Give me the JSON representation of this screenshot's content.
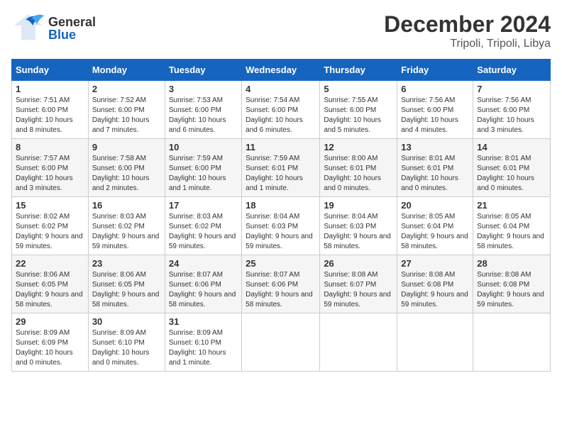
{
  "header": {
    "logo_general": "General",
    "logo_blue": "Blue",
    "title": "December 2024",
    "subtitle": "Tripoli, Tripoli, Libya"
  },
  "days_of_week": [
    "Sunday",
    "Monday",
    "Tuesday",
    "Wednesday",
    "Thursday",
    "Friday",
    "Saturday"
  ],
  "weeks": [
    [
      {
        "num": "1",
        "sunrise": "Sunrise: 7:51 AM",
        "sunset": "Sunset: 6:00 PM",
        "daylight": "Daylight: 10 hours and 8 minutes."
      },
      {
        "num": "2",
        "sunrise": "Sunrise: 7:52 AM",
        "sunset": "Sunset: 6:00 PM",
        "daylight": "Daylight: 10 hours and 7 minutes."
      },
      {
        "num": "3",
        "sunrise": "Sunrise: 7:53 AM",
        "sunset": "Sunset: 6:00 PM",
        "daylight": "Daylight: 10 hours and 6 minutes."
      },
      {
        "num": "4",
        "sunrise": "Sunrise: 7:54 AM",
        "sunset": "Sunset: 6:00 PM",
        "daylight": "Daylight: 10 hours and 6 minutes."
      },
      {
        "num": "5",
        "sunrise": "Sunrise: 7:55 AM",
        "sunset": "Sunset: 6:00 PM",
        "daylight": "Daylight: 10 hours and 5 minutes."
      },
      {
        "num": "6",
        "sunrise": "Sunrise: 7:56 AM",
        "sunset": "Sunset: 6:00 PM",
        "daylight": "Daylight: 10 hours and 4 minutes."
      },
      {
        "num": "7",
        "sunrise": "Sunrise: 7:56 AM",
        "sunset": "Sunset: 6:00 PM",
        "daylight": "Daylight: 10 hours and 3 minutes."
      }
    ],
    [
      {
        "num": "8",
        "sunrise": "Sunrise: 7:57 AM",
        "sunset": "Sunset: 6:00 PM",
        "daylight": "Daylight: 10 hours and 3 minutes."
      },
      {
        "num": "9",
        "sunrise": "Sunrise: 7:58 AM",
        "sunset": "Sunset: 6:00 PM",
        "daylight": "Daylight: 10 hours and 2 minutes."
      },
      {
        "num": "10",
        "sunrise": "Sunrise: 7:59 AM",
        "sunset": "Sunset: 6:00 PM",
        "daylight": "Daylight: 10 hours and 1 minute."
      },
      {
        "num": "11",
        "sunrise": "Sunrise: 7:59 AM",
        "sunset": "Sunset: 6:01 PM",
        "daylight": "Daylight: 10 hours and 1 minute."
      },
      {
        "num": "12",
        "sunrise": "Sunrise: 8:00 AM",
        "sunset": "Sunset: 6:01 PM",
        "daylight": "Daylight: 10 hours and 0 minutes."
      },
      {
        "num": "13",
        "sunrise": "Sunrise: 8:01 AM",
        "sunset": "Sunset: 6:01 PM",
        "daylight": "Daylight: 10 hours and 0 minutes."
      },
      {
        "num": "14",
        "sunrise": "Sunrise: 8:01 AM",
        "sunset": "Sunset: 6:01 PM",
        "daylight": "Daylight: 10 hours and 0 minutes."
      }
    ],
    [
      {
        "num": "15",
        "sunrise": "Sunrise: 8:02 AM",
        "sunset": "Sunset: 6:02 PM",
        "daylight": "Daylight: 9 hours and 59 minutes."
      },
      {
        "num": "16",
        "sunrise": "Sunrise: 8:03 AM",
        "sunset": "Sunset: 6:02 PM",
        "daylight": "Daylight: 9 hours and 59 minutes."
      },
      {
        "num": "17",
        "sunrise": "Sunrise: 8:03 AM",
        "sunset": "Sunset: 6:02 PM",
        "daylight": "Daylight: 9 hours and 59 minutes."
      },
      {
        "num": "18",
        "sunrise": "Sunrise: 8:04 AM",
        "sunset": "Sunset: 6:03 PM",
        "daylight": "Daylight: 9 hours and 59 minutes."
      },
      {
        "num": "19",
        "sunrise": "Sunrise: 8:04 AM",
        "sunset": "Sunset: 6:03 PM",
        "daylight": "Daylight: 9 hours and 58 minutes."
      },
      {
        "num": "20",
        "sunrise": "Sunrise: 8:05 AM",
        "sunset": "Sunset: 6:04 PM",
        "daylight": "Daylight: 9 hours and 58 minutes."
      },
      {
        "num": "21",
        "sunrise": "Sunrise: 8:05 AM",
        "sunset": "Sunset: 6:04 PM",
        "daylight": "Daylight: 9 hours and 58 minutes."
      }
    ],
    [
      {
        "num": "22",
        "sunrise": "Sunrise: 8:06 AM",
        "sunset": "Sunset: 6:05 PM",
        "daylight": "Daylight: 9 hours and 58 minutes."
      },
      {
        "num": "23",
        "sunrise": "Sunrise: 8:06 AM",
        "sunset": "Sunset: 6:05 PM",
        "daylight": "Daylight: 9 hours and 58 minutes."
      },
      {
        "num": "24",
        "sunrise": "Sunrise: 8:07 AM",
        "sunset": "Sunset: 6:06 PM",
        "daylight": "Daylight: 9 hours and 58 minutes."
      },
      {
        "num": "25",
        "sunrise": "Sunrise: 8:07 AM",
        "sunset": "Sunset: 6:06 PM",
        "daylight": "Daylight: 9 hours and 58 minutes."
      },
      {
        "num": "26",
        "sunrise": "Sunrise: 8:08 AM",
        "sunset": "Sunset: 6:07 PM",
        "daylight": "Daylight: 9 hours and 59 minutes."
      },
      {
        "num": "27",
        "sunrise": "Sunrise: 8:08 AM",
        "sunset": "Sunset: 6:08 PM",
        "daylight": "Daylight: 9 hours and 59 minutes."
      },
      {
        "num": "28",
        "sunrise": "Sunrise: 8:08 AM",
        "sunset": "Sunset: 6:08 PM",
        "daylight": "Daylight: 9 hours and 59 minutes."
      }
    ],
    [
      {
        "num": "29",
        "sunrise": "Sunrise: 8:09 AM",
        "sunset": "Sunset: 6:09 PM",
        "daylight": "Daylight: 10 hours and 0 minutes."
      },
      {
        "num": "30",
        "sunrise": "Sunrise: 8:09 AM",
        "sunset": "Sunset: 6:10 PM",
        "daylight": "Daylight: 10 hours and 0 minutes."
      },
      {
        "num": "31",
        "sunrise": "Sunrise: 8:09 AM",
        "sunset": "Sunset: 6:10 PM",
        "daylight": "Daylight: 10 hours and 1 minute."
      },
      null,
      null,
      null,
      null
    ]
  ]
}
